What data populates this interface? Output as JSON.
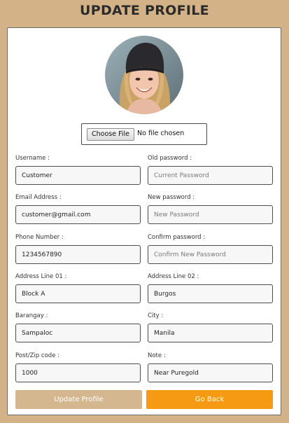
{
  "header": {
    "title": "UPDATE PROFILE"
  },
  "avatar": {
    "alt": "profile photo"
  },
  "upload": {
    "button_label": "Choose File",
    "status": "No file chosen"
  },
  "fields": {
    "username": {
      "label": "Username :",
      "value": "Customer",
      "placeholder": ""
    },
    "old_password": {
      "label": "Old password :",
      "value": "",
      "placeholder": "Current Password"
    },
    "email": {
      "label": "Email Address :",
      "value": "customer@gmail.com",
      "placeholder": ""
    },
    "new_password": {
      "label": "New password :",
      "value": "",
      "placeholder": "New Password"
    },
    "phone": {
      "label": "Phone Number :",
      "value": "1234567890",
      "placeholder": ""
    },
    "confirm_password": {
      "label": "Confirm password :",
      "value": "",
      "placeholder": "Confirm New Password"
    },
    "address1": {
      "label": "Address Line 01 :",
      "value": "Block A",
      "placeholder": ""
    },
    "address2": {
      "label": "Address Line 02 :",
      "value": "Burgos",
      "placeholder": ""
    },
    "barangay": {
      "label": "Barangay :",
      "value": "Sampaloc",
      "placeholder": ""
    },
    "city": {
      "label": "City :",
      "value": "Manila",
      "placeholder": ""
    },
    "zip": {
      "label": "Post/Zip code :",
      "value": "1000",
      "placeholder": ""
    },
    "note": {
      "label": "Note :",
      "value": "Near Puregold",
      "placeholder": ""
    }
  },
  "actions": {
    "update_label": "Update Profile",
    "back_label": "Go Back"
  },
  "colors": {
    "background": "#d3b287",
    "update_button": "#d4b68f",
    "back_button": "#f59a12"
  }
}
